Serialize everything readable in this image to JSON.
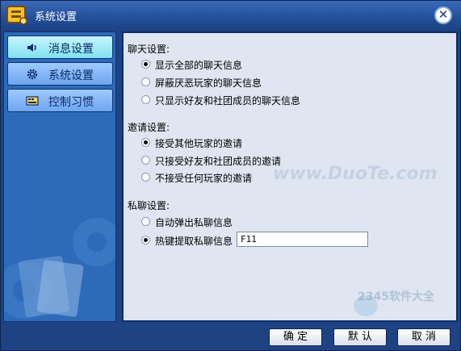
{
  "window": {
    "title": "系统设置",
    "close_label": "✕"
  },
  "sidebar": {
    "items": [
      {
        "label": "消息设置",
        "icon": "speaker-icon"
      },
      {
        "label": "系统设置",
        "icon": "gear-icon"
      },
      {
        "label": "控制习惯",
        "icon": "keyboard-icon"
      }
    ]
  },
  "chat": {
    "heading": "聊天设置:",
    "options": [
      {
        "label": "显示全部的聊天信息",
        "selected": true
      },
      {
        "label": "屏蔽厌恶玩家的聊天信息",
        "selected": false
      },
      {
        "label": "只显示好友和社团成员的聊天信息",
        "selected": false
      }
    ]
  },
  "invite": {
    "heading": "邀请设置:",
    "options": [
      {
        "label": "接受其他玩家的邀请",
        "selected": true
      },
      {
        "label": "只接受好友和社团成员的邀请",
        "selected": false
      },
      {
        "label": "不接受任何玩家的邀请",
        "selected": false
      }
    ]
  },
  "private_chat": {
    "heading": "私聊设置:",
    "options": [
      {
        "label": "自动弹出私聊信息",
        "selected": false
      },
      {
        "label": "热键提取私聊信息",
        "selected": true
      }
    ],
    "hotkey_value": "F11"
  },
  "watermark": {
    "text1": "www.DuoTe.com",
    "text2": "2345软件大全"
  },
  "buttons": {
    "ok": "确 定",
    "default": "默 认",
    "cancel": "取 消"
  }
}
